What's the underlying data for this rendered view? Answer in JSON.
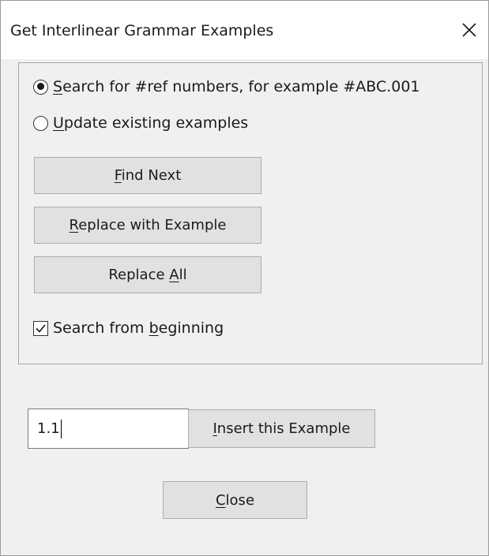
{
  "window": {
    "title": "Get Interlinear Grammar Examples",
    "close_glyph": "close-icon"
  },
  "options": {
    "search_refs": {
      "accel": "S",
      "rest": "earch for #ref numbers, for example #ABC.001",
      "selected": true
    },
    "update_existing": {
      "accel": "U",
      "rest": "pdate existing examples",
      "selected": false
    }
  },
  "buttons": {
    "find_next": {
      "accel": "F",
      "rest": "ind Next"
    },
    "replace_with_example": {
      "accel": "R",
      "rest": "eplace with Example"
    },
    "replace_all": {
      "pre": "Replace ",
      "accel": "A",
      "rest": "ll"
    },
    "insert_example": {
      "accel": "I",
      "rest": "nsert this Example"
    },
    "close": {
      "accel": "C",
      "rest": "lose"
    }
  },
  "search_from_beginning": {
    "pre": "Search from ",
    "accel": "b",
    "rest": "eginning",
    "checked": true
  },
  "example_input": {
    "value": "1.1"
  },
  "colors": {
    "button_face": "#e1e1e1",
    "dialog_bg": "#f0f0f0"
  }
}
